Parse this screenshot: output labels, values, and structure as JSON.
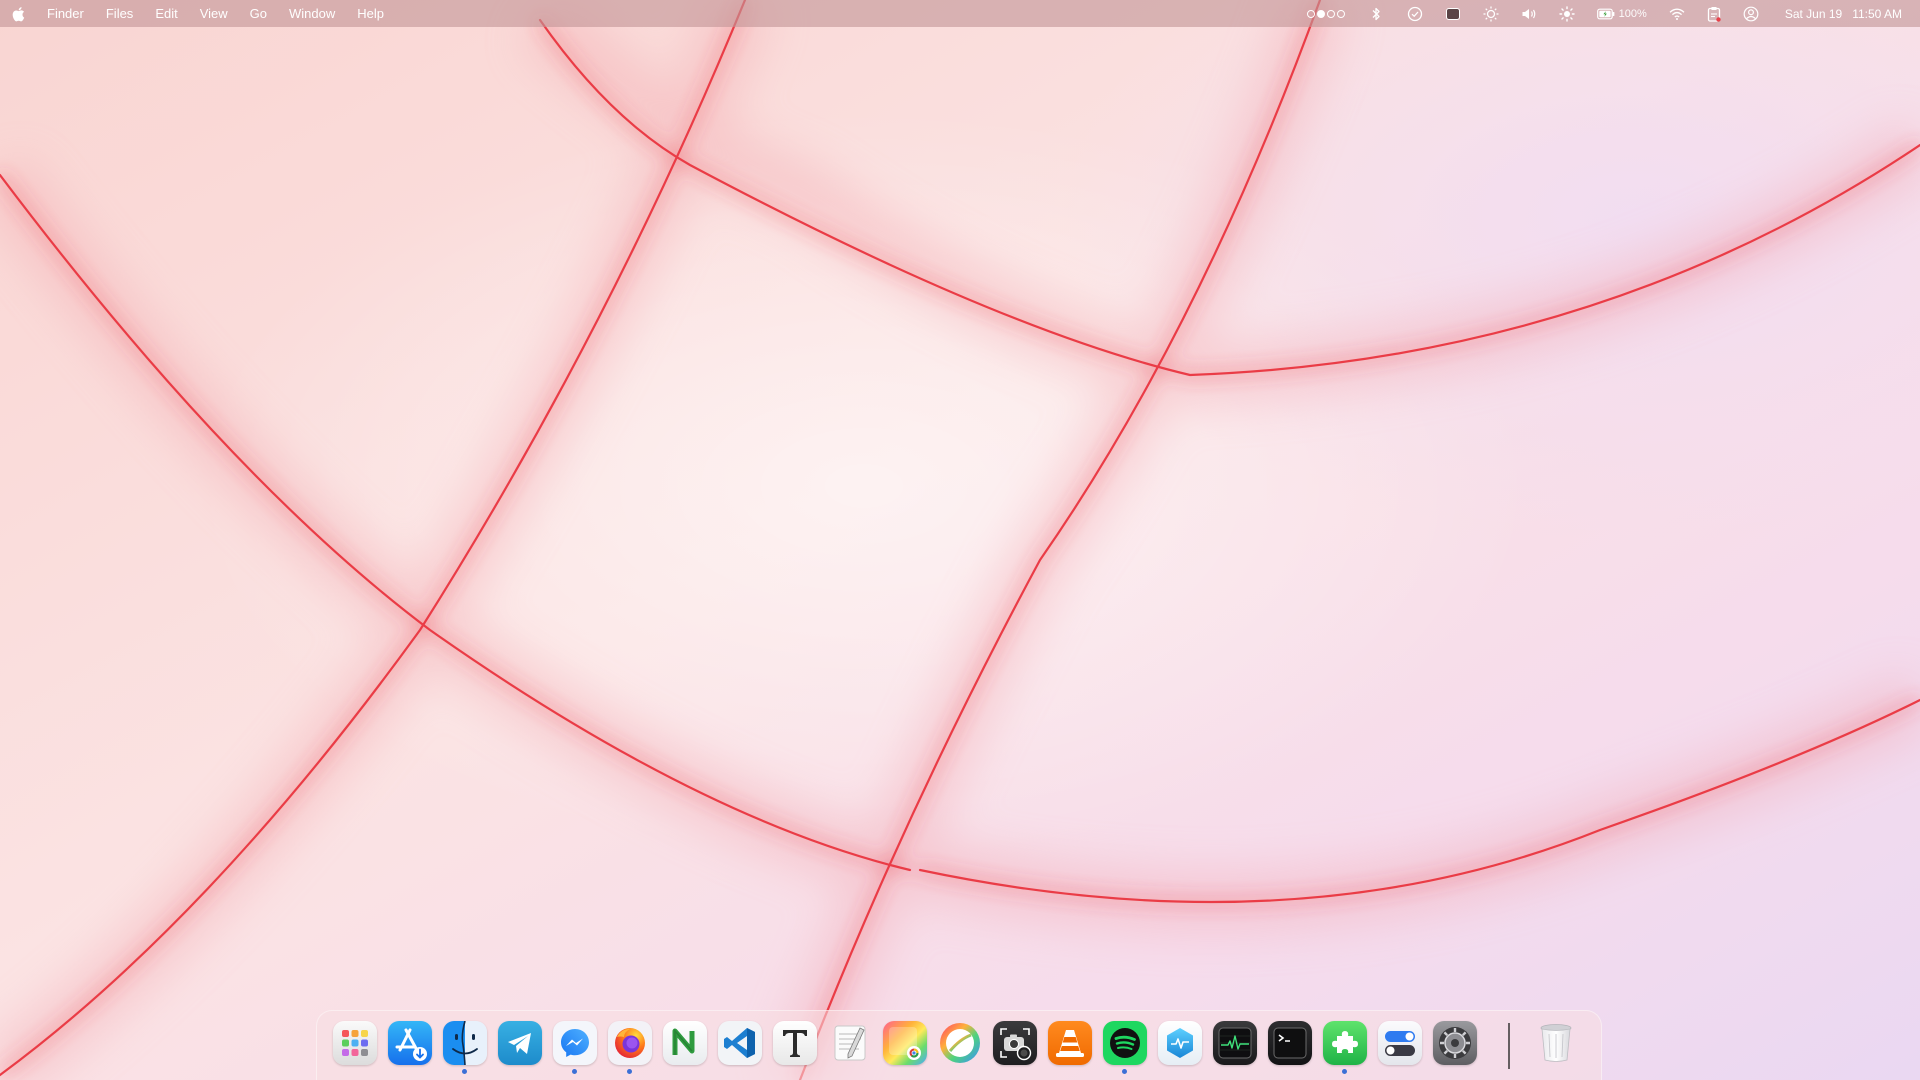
{
  "menubar": {
    "apple_icon": "apple-logo-icon",
    "menus": [
      "Finder",
      "Files",
      "Edit",
      "View",
      "Go",
      "Window",
      "Help"
    ],
    "status_icons": [
      "workspace-dots-icon",
      "bluetooth-icon",
      "check-circle-icon",
      "screen-record-icon",
      "night-light-icon",
      "volume-icon",
      "brightness-icon",
      "battery-icon",
      "wifi-icon",
      "clipboard-icon",
      "user-account-icon"
    ],
    "battery_percent": "100%",
    "clock": "Sat Jun 19   11:50 AM"
  },
  "dock": {
    "apps": [
      {
        "name": "launchpad",
        "running": false
      },
      {
        "name": "app-store",
        "running": false
      },
      {
        "name": "finder",
        "running": true
      },
      {
        "name": "telegram",
        "running": false
      },
      {
        "name": "messenger",
        "running": true
      },
      {
        "name": "firefox",
        "running": true
      },
      {
        "name": "nvidia-settings",
        "running": false
      },
      {
        "name": "visual-studio-code",
        "running": false
      },
      {
        "name": "typora",
        "running": false
      },
      {
        "name": "text-editor",
        "running": false
      },
      {
        "name": "photos-viewer",
        "running": false
      },
      {
        "name": "browser-circle",
        "running": false
      },
      {
        "name": "screenshot",
        "running": false
      },
      {
        "name": "vlc",
        "running": false
      },
      {
        "name": "spotify",
        "running": true
      },
      {
        "name": "hexagon-app",
        "running": false
      },
      {
        "name": "activity-monitor",
        "running": false
      },
      {
        "name": "terminal",
        "running": false
      },
      {
        "name": "extensions",
        "running": true
      },
      {
        "name": "tweaks",
        "running": false
      },
      {
        "name": "system-settings",
        "running": false
      }
    ],
    "trash": {
      "name": "trash"
    }
  },
  "colors": {
    "wallpaper_base": "#f8dcdc",
    "wallpaper_stroke": "#e8404a",
    "running_indicator": "#3b6fd6"
  }
}
